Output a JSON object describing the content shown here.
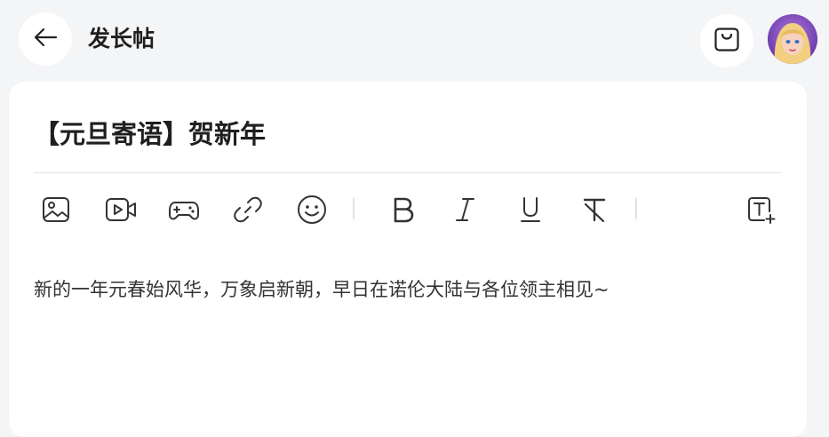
{
  "header": {
    "title": "发长帖",
    "back_icon": "arrow-left-icon",
    "bag_icon": "shopping-bag-icon",
    "avatar": "user-avatar"
  },
  "post": {
    "title": "【元旦寄语】贺新年",
    "body": "新的一年元春始风华，万象启新朝，早日在诺伦大陆与各位领主相见~"
  },
  "toolbar": {
    "icons": [
      "image-icon",
      "video-icon",
      "gamepad-icon",
      "link-icon",
      "emoji-icon",
      "bold-icon",
      "italic-icon",
      "underline-icon",
      "clear-format-icon",
      "text-add-icon"
    ]
  },
  "colors": {
    "page_background": "#f4f5f7",
    "card_background": "#ffffff",
    "text_primary": "#1f1f1f",
    "icon": "#333333"
  }
}
